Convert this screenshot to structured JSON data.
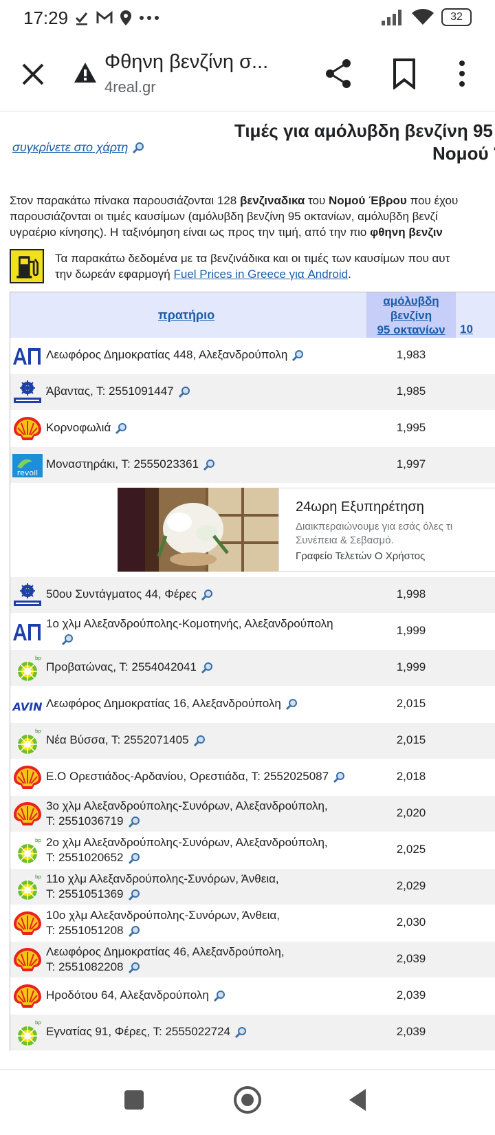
{
  "status": {
    "time": "17:29",
    "battery": "32"
  },
  "browser": {
    "title": "Φθηνη βενζίνη σ...",
    "url": "4real.gr"
  },
  "page": {
    "heading_line1": "Τιμές για αμόλυβδη βενζίνη 95 ο",
    "heading_line2": "Νομού Έ",
    "compare_link": "συγκρίνετε στο χάρτη",
    "intro_line1_a": "Στον παρακάτω πίνακα παρουσιάζονται 128 ",
    "intro_line1_b": "βενζιναδικα",
    "intro_line1_c": " του ",
    "intro_line1_d": "Νομού Έβρου",
    "intro_line1_e": " που έχου",
    "intro_line2": "παρουσιάζονται οι τιμές καυσίμων (αμόλυβδη βενζίνη 95 οκτανίων, αμόλυβδη βενζί",
    "intro_line3_a": "υγραέριο κίνησης). Η ταξινόμηση είναι ως προς την τιμή, από την πιο ",
    "intro_line3_b": "φθηνη βενζιν",
    "fuel_note_line1": "Τα παρακάτω δεδομένα με τα βενζινάδικα και οι τιμές των καυσίμων που αυτ",
    "fuel_note_line2_a": "την δωρεάν εφαρμογή ",
    "fuel_note_link": "Fuel Prices in Greece για Android",
    "fuel_note_line2_b": "."
  },
  "table": {
    "header_station": "πρατήριο",
    "header_price_l1": "αμόλυβδη",
    "header_price_l2": "βενζίνη",
    "header_price_l3": "95 οκτανίων",
    "header_next": "10",
    "rows_top": [
      {
        "brand": "ap",
        "addr": "Λεωφόρος Δημοκρατίας 448, Αλεξανδρούπολη",
        "price": "1,983"
      },
      {
        "brand": "aegean",
        "addr": "Άβαντας, Τ: 2551091447",
        "price": "1,985"
      },
      {
        "brand": "shell",
        "addr": "Κορνοφωλιά",
        "price": "1,995"
      },
      {
        "brand": "revoil",
        "addr": "Μοναστηράκι, Τ: 2555023361",
        "price": "1,997"
      }
    ],
    "rows_bottom": [
      {
        "brand": "aegean",
        "addr": "50ου Συντάγματος 44, Φέρες",
        "price": "1,998"
      },
      {
        "brand": "ap",
        "addr": "1ο χλμ Αλεξανδρούπολης-Κομοτηνής, Αλεξανδρούπολη",
        "addr2": "",
        "price": "1,999"
      },
      {
        "brand": "bp",
        "addr": "Προβατώνας, Τ: 2554042041",
        "price": "1,999"
      },
      {
        "brand": "avin",
        "addr": "Λεωφόρος Δημοκρατίας 16, Αλεξανδρούπολη",
        "price": "2,015"
      },
      {
        "brand": "bp",
        "addr": "Νέα Βύσσα, Τ: 2552071405",
        "price": "2,015"
      },
      {
        "brand": "shell",
        "addr": "Ε.Ο Ορεστιάδος-Αρδανίου, Ορεστιάδα, Τ: 2552025087",
        "price": "2,018"
      },
      {
        "brand": "shell",
        "addr": "3ο χλμ Αλεξανδρούπολης-Συνόρων, Αλεξανδρούπολη,",
        "addr2": "Τ: 2551036719",
        "price": "2,020"
      },
      {
        "brand": "bp",
        "addr": "2ο χλμ Αλεξανδρούπολης-Συνόρων, Αλεξανδρούπολη,",
        "addr2": "Τ: 2551020652",
        "price": "2,025"
      },
      {
        "brand": "bp",
        "addr": "11ο χλμ Αλεξανδρούπολης-Συνόρων, Άνθεια,",
        "addr2": "Τ: 2551051369",
        "price": "2,029"
      },
      {
        "brand": "shell",
        "addr": "10ο χλμ Αλεξανδρούπολης-Συνόρων, Άνθεια,",
        "addr2": "Τ: 2551051208",
        "price": "2,030"
      },
      {
        "brand": "shell",
        "addr": "Λεωφόρος Δημοκρατίας 46, Αλεξανδρούπολη,",
        "addr2": "Τ: 2551082208",
        "price": "2,039"
      },
      {
        "brand": "shell",
        "addr": "Ηροδότου 64, Αλεξανδρούπολη",
        "price": "2,039"
      },
      {
        "brand": "bp",
        "addr": "Εγνατίας 91, Φέρες, Τ: 2555022724",
        "price": "2,039"
      }
    ]
  },
  "ad": {
    "title": "24ωρη Εξυπηρέτηση",
    "desc_line1": "Διαικπεραιώνουμε για εσάς όλες τι",
    "desc_line2": "Συνέπεια & Σεβασμό.",
    "source": "Γραφείο Τελετών Ο Χρήστος"
  },
  "icons": {
    "close": "close-icon",
    "warning": "warning-icon",
    "share": "share-icon",
    "bookmark": "bookmark-icon",
    "menu": "more-vert-icon"
  }
}
